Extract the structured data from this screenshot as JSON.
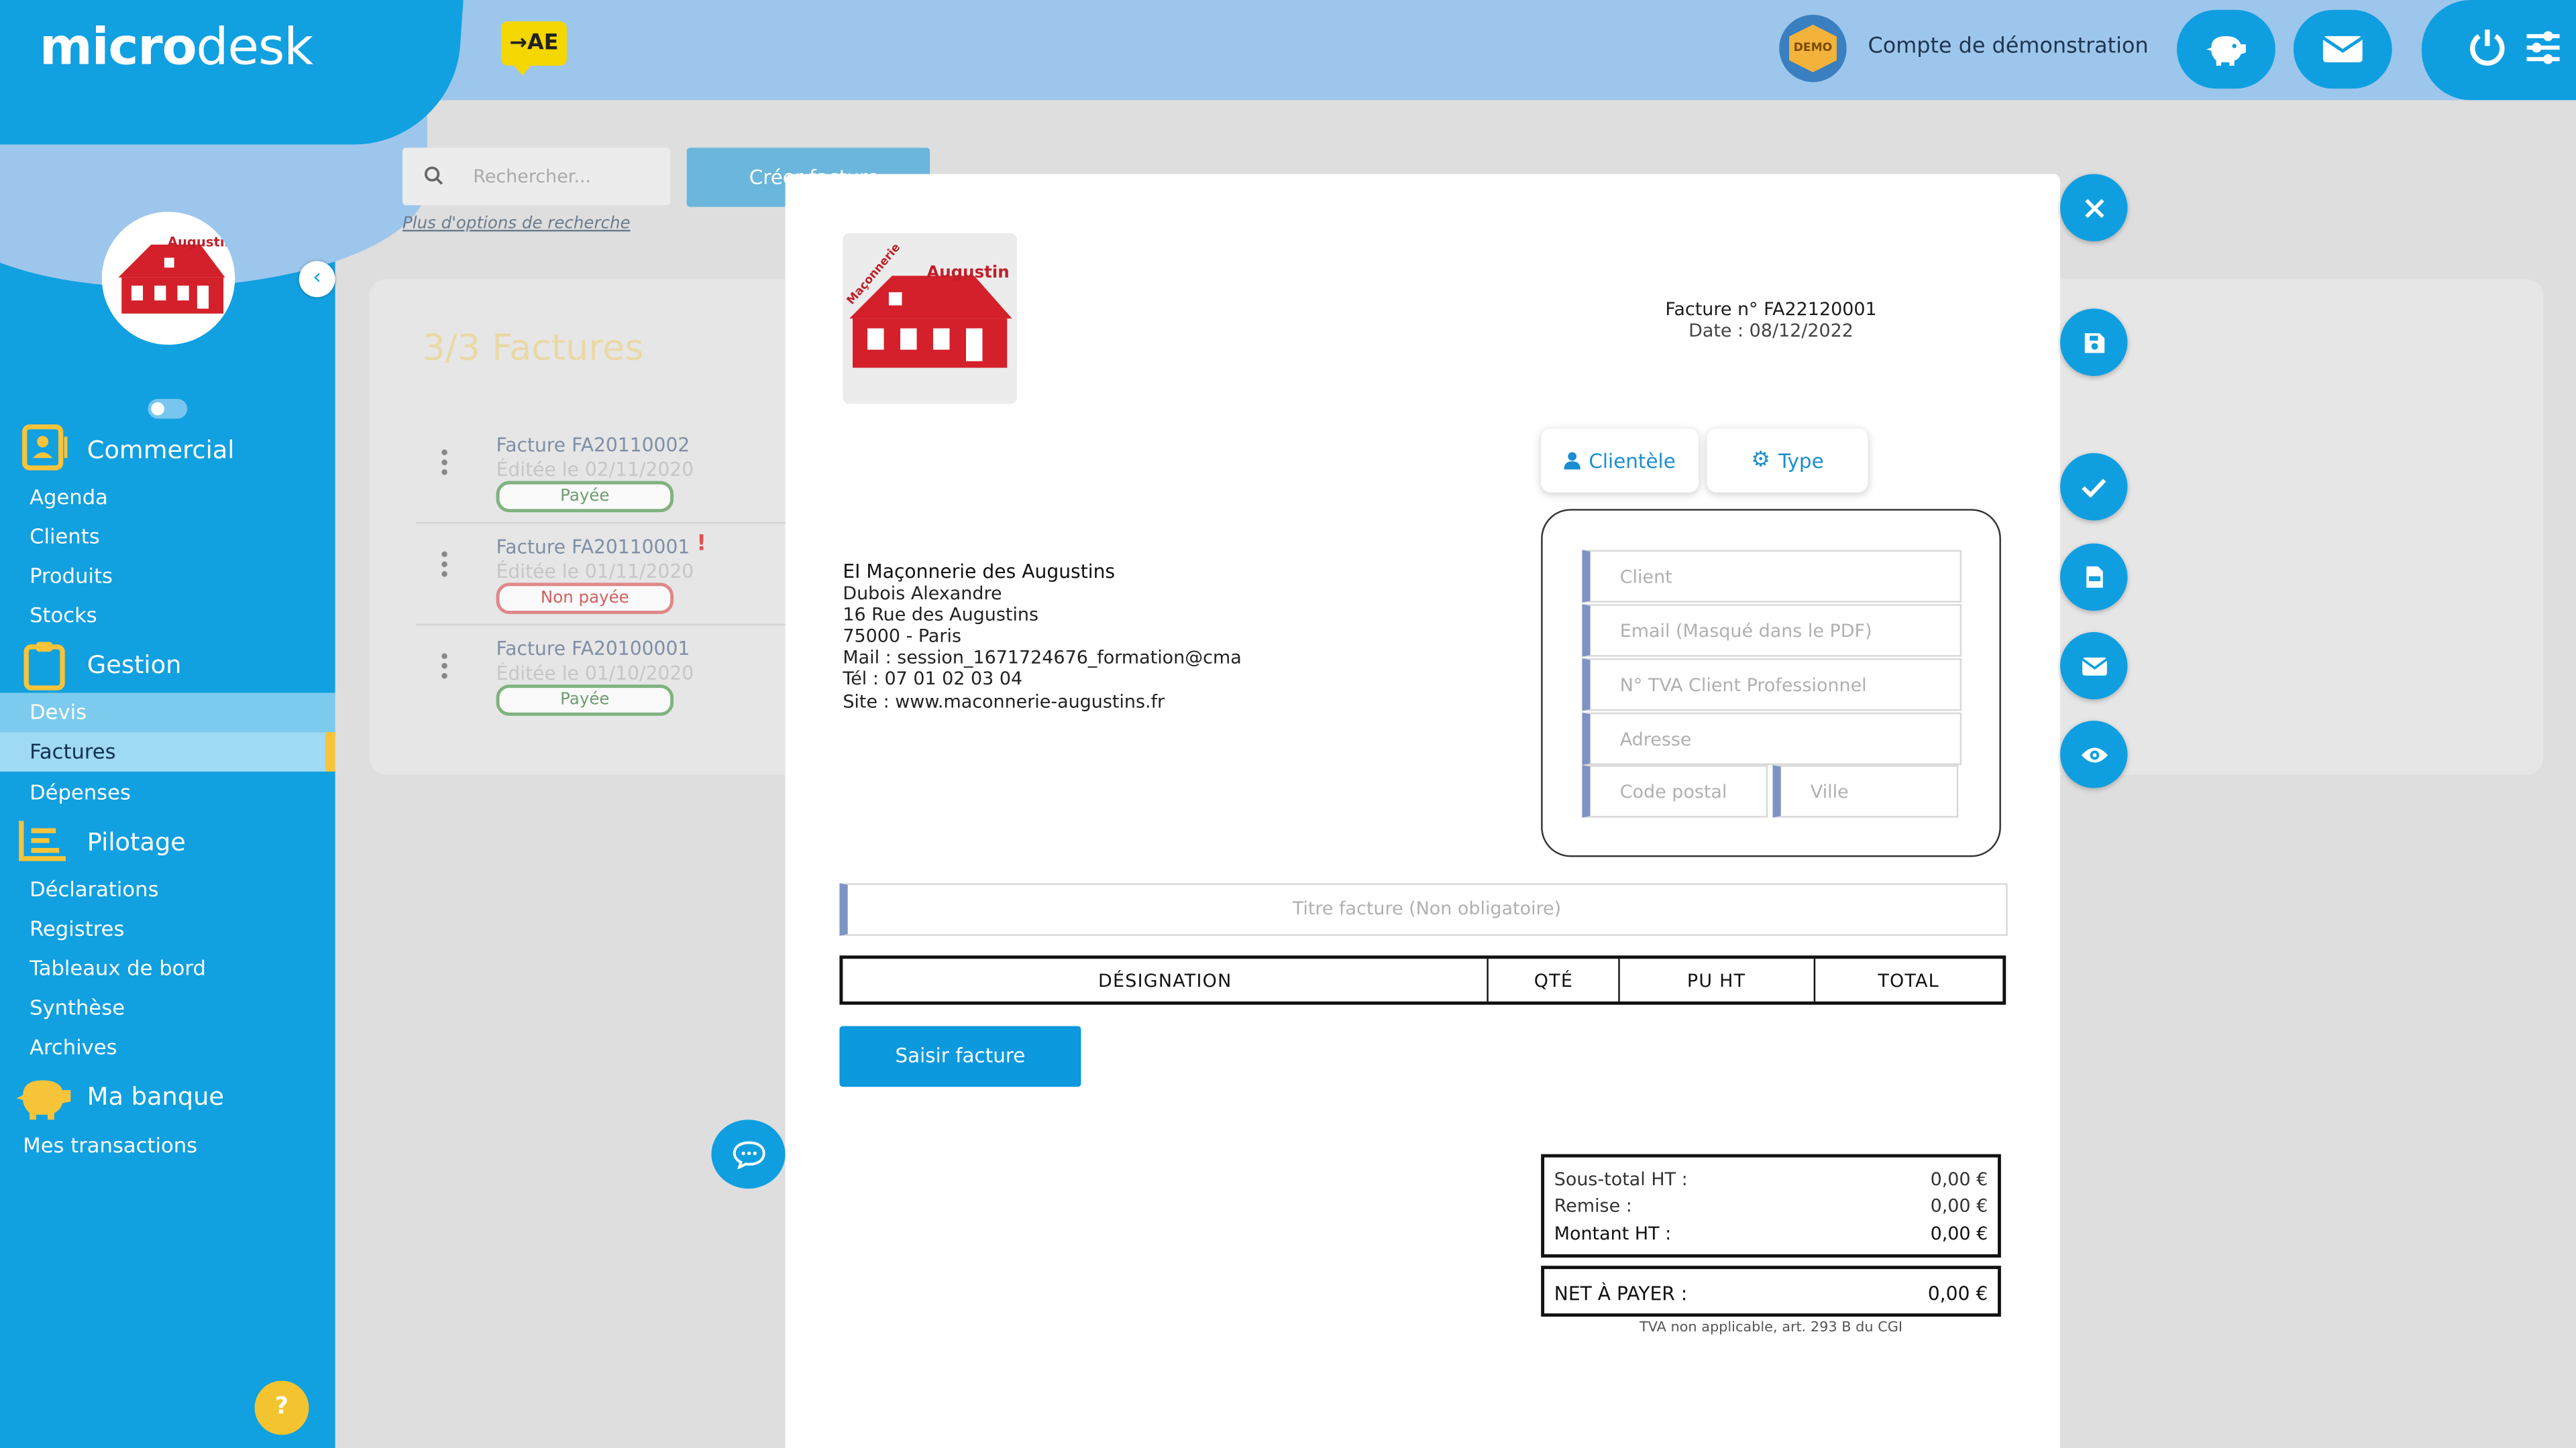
{
  "app": {
    "logo_bold": "micro",
    "logo_light": "desk",
    "ae_badge": "→AE",
    "account_name": "Compte de démonstration",
    "demo_label": "DEMO",
    "company_logo_text": "Augustin",
    "company_logo_side": "Maçonnerie"
  },
  "sidebar": {
    "sections": [
      {
        "title": "Commercial",
        "items": [
          "Agenda",
          "Clients",
          "Produits",
          "Stocks"
        ]
      },
      {
        "title": "Gestion",
        "items": [
          "Devis",
          "Factures",
          "Dépenses"
        ]
      },
      {
        "title": "Pilotage",
        "items": [
          "Déclarations",
          "Registres",
          "Tableaux de bord",
          "Synthèse",
          "Archives"
        ]
      },
      {
        "title": "Ma banque",
        "items": [
          "Mes transactions"
        ]
      }
    ],
    "active_item": "Factures",
    "hover_item": "Devis",
    "help_label": "?"
  },
  "list": {
    "search_placeholder": "Rechercher...",
    "create_label": "Créer facture",
    "more_options": "Plus d'options de recherche",
    "count_label": "3/3 Factures",
    "invoices": [
      {
        "title": "Facture FA20110002",
        "date": "Éditée le 02/11/2020",
        "status": "Payée",
        "warning": ""
      },
      {
        "title": "Facture FA20110001",
        "date": "Éditée le 01/11/2020",
        "status": "Non payée",
        "warning": "!"
      },
      {
        "title": "Facture FA20100001",
        "date": "Éditée le 01/10/2020",
        "status": "Payée",
        "warning": ""
      }
    ]
  },
  "modal": {
    "invoice_number": "Facture n° FA22120001",
    "invoice_date": "Date : 08/12/2022",
    "tabs": {
      "clientele": "Clientèle",
      "type": "Type"
    },
    "company": {
      "name": "EI Maçonnerie des Augustins",
      "owner": "Dubois Alexandre",
      "street": "16 Rue des Augustins",
      "city": "75000 - Paris",
      "mail": "Mail : session_1671724676_formation@cma",
      "phone": "Tél : 07 01 02 03 04",
      "site": "Site : www.maconnerie-augustins.fr"
    },
    "client_fields": {
      "client": "Client",
      "email": "Email (Masqué dans le PDF)",
      "tva": "N° TVA Client Professionnel",
      "address": "Adresse",
      "postal": "Code postal",
      "city": "Ville"
    },
    "title_placeholder": "Titre facture (Non obligatoire)",
    "table_headers": [
      "DÉSIGNATION",
      "QTÉ",
      "PU HT",
      "TOTAL"
    ],
    "enter_button": "Saisir facture",
    "totals": {
      "subtotal_label": "Sous-total HT :",
      "subtotal": "0,00 €",
      "discount_label": "Remise :",
      "discount": "0,00 €",
      "amount_label": "Montant HT :",
      "amount": "0,00 €",
      "net_label": "NET À PAYER :",
      "net": "0,00 €"
    },
    "tva_note": "TVA non applicable, art. 293 B du CGI"
  },
  "colors": {
    "primary": "#11a0e0",
    "topbar": "#9dc6ec",
    "accent": "#f8c43a"
  },
  "icons": [
    "close-icon",
    "save-icon",
    "check-icon",
    "pdf-icon",
    "mail-icon",
    "eye-icon",
    "piggy-bank-icon",
    "power-icon",
    "sliders-icon",
    "chat-icon",
    "search-icon",
    "user-icon",
    "gear-icon"
  ]
}
